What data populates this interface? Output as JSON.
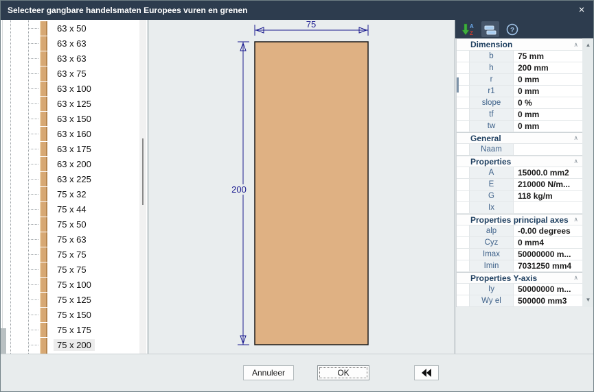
{
  "window": {
    "title": "Selecteer gangbare handelsmaten Europees vuren en grenen",
    "close": "×"
  },
  "tree": {
    "items": [
      "63 x 50",
      "63 x 63",
      "63 x 63",
      "63 x 75",
      "63 x 100",
      "63 x 125",
      "63 x 150",
      "63 x 160",
      "63 x 175",
      "63 x 200",
      "63 x 225",
      "75 x 32",
      "75 x 44",
      "75 x 50",
      "75 x 63",
      "75 x 75",
      "75 x 75",
      "75 x 100",
      "75 x 125",
      "75 x 150",
      "75 x 175",
      "75 x 200"
    ],
    "selected_index": 21,
    "selected_label": "75 x 200"
  },
  "drawing": {
    "width_label": "75",
    "height_label": "200",
    "section_fill": "#dfb183",
    "dimension_color": "#1a1a8f"
  },
  "toolbar": {
    "icons": [
      {
        "name": "sort-az-icon",
        "letters": [
          "A",
          "Z"
        ]
      },
      {
        "name": "layout-bars-icon"
      },
      {
        "name": "help-icon",
        "glyph": "?"
      }
    ]
  },
  "properties": {
    "sections": [
      {
        "title": "Dimension",
        "rows": [
          [
            "b",
            "75 mm"
          ],
          [
            "h",
            "200 mm"
          ],
          [
            "r",
            "0 mm"
          ],
          [
            "r1",
            "0 mm"
          ],
          [
            "slope",
            "0 %"
          ],
          [
            "tf",
            "0 mm"
          ],
          [
            "tw",
            "0 mm"
          ]
        ]
      },
      {
        "title": "General",
        "rows": [
          [
            "Naam",
            ""
          ]
        ]
      },
      {
        "title": "Properties",
        "rows": [
          [
            "A",
            "15000.0 mm2"
          ],
          [
            "E",
            "210000 N/m..."
          ],
          [
            "G",
            "118 kg/m"
          ],
          [
            "Ix",
            ""
          ]
        ]
      },
      {
        "title": "Properties principal axes",
        "rows": [
          [
            "alp",
            "-0.00 degrees"
          ],
          [
            "Cyz",
            "0 mm4"
          ],
          [
            "Imax",
            "50000000 m..."
          ],
          [
            "Imin",
            "7031250 mm4"
          ]
        ]
      },
      {
        "title": "Properties Y-axis",
        "rows": [
          [
            "Iy",
            "50000000 m..."
          ],
          [
            "Wy el",
            "500000 mm3"
          ]
        ]
      }
    ]
  },
  "footer": {
    "cancel_label": "Annuleer",
    "ok_label": "OK"
  },
  "colors": {
    "titlebar": "#2d3c4e",
    "panel_bg": "#e9edee",
    "accent_tan": "#dfb183",
    "dim_navy": "#1a1a8f"
  }
}
